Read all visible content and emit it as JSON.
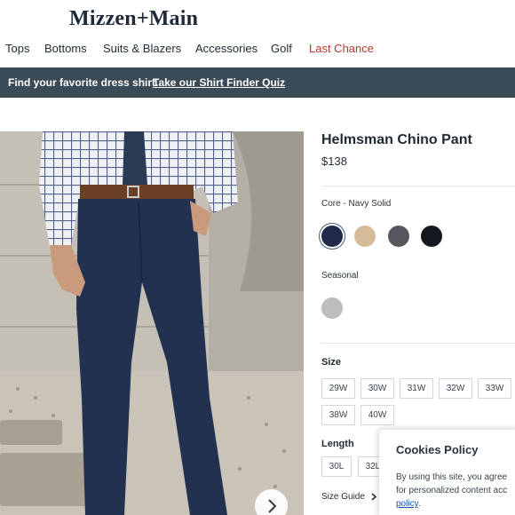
{
  "header": {
    "logo_text": "Mizzen+Main"
  },
  "nav": {
    "items": [
      {
        "label": "Tops"
      },
      {
        "label": "Bottoms"
      },
      {
        "label": "Suits & Blazers"
      },
      {
        "label": "Accessories"
      },
      {
        "label": "Golf"
      },
      {
        "label": "Last Chance",
        "color": "#b4382e"
      }
    ]
  },
  "banner": {
    "text": "Find your favorite dress shirt.",
    "link_text": "Take our Shirt Finder Quiz",
    "background": "#3a4a57"
  },
  "gallery": {
    "next_icon": "chevron-right-icon"
  },
  "product": {
    "name": "Helmsman Chino Pant",
    "price": "$138",
    "core_label": "Core - Navy Solid",
    "core_swatches": [
      {
        "color": "#1f2a4a",
        "selected": true
      },
      {
        "color": "#d5bb9a",
        "selected": false
      },
      {
        "color": "#56575e",
        "selected": false
      },
      {
        "color": "#16181f",
        "selected": false
      }
    ],
    "seasonal_label": "Seasonal",
    "seasonal_swatches": [
      {
        "color": "#bdbdbd",
        "selected": false
      }
    ],
    "size_label": "Size",
    "sizes": [
      "29W",
      "30W",
      "31W",
      "32W",
      "33W",
      "38W",
      "40W"
    ],
    "length_label": "Length",
    "lengths": [
      "30L",
      "32L"
    ],
    "size_guide": "Size Guide",
    "size_guide_icon": "chevron-right-icon"
  },
  "cookie": {
    "title": "Cookies Policy",
    "body": "By using this site, you agree",
    "body_2": "for personalized content acc",
    "link_text": "policy",
    "after_link": "."
  }
}
